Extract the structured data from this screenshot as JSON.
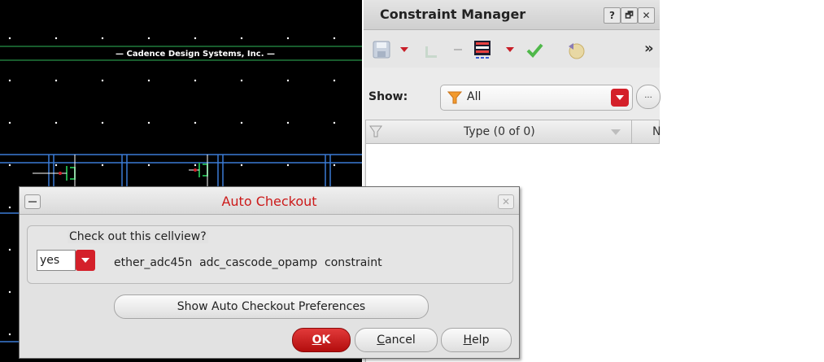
{
  "canvas": {
    "banner_text": "— Cadence Design Systems, Inc. —"
  },
  "constraint_manager": {
    "title": "Constraint Manager",
    "title_buttons": {
      "help": "?",
      "restore": "🗗",
      "close": "✕"
    },
    "toolbar": {
      "icons": [
        "save-icon",
        "dropdown-icon",
        "filter-hierarchy-icon",
        "minus-icon",
        "grid-icon",
        "dropdown-icon",
        "check-icon",
        "undo-icon"
      ],
      "overflow": "»"
    },
    "show": {
      "label": "Show:",
      "value": "All",
      "more_button": "..."
    },
    "table": {
      "column_type": "Type (0 of 0)",
      "column_next": "N"
    }
  },
  "dialog": {
    "title": "Auto Checkout",
    "question": "Check out this cellview?",
    "select_value": "yes",
    "cellview_text": "ether_adc45n  adc_cascode_opamp  constraint",
    "prefs_button": "Show Auto Checkout Preferences",
    "ok_label": "OK",
    "ok_underline": "O",
    "ok_rest": "K",
    "cancel_underline": "C",
    "cancel_rest": "ancel",
    "help_underline": "H",
    "help_rest": "elp"
  },
  "colors": {
    "canvas_bg": "#000000",
    "grid_dot": "#ffffff",
    "wire_blue": "#3a7bd5",
    "wire_green": "#1fa84a",
    "accent_red": "#d4202a",
    "dialog_title": "#cc1a1a"
  }
}
